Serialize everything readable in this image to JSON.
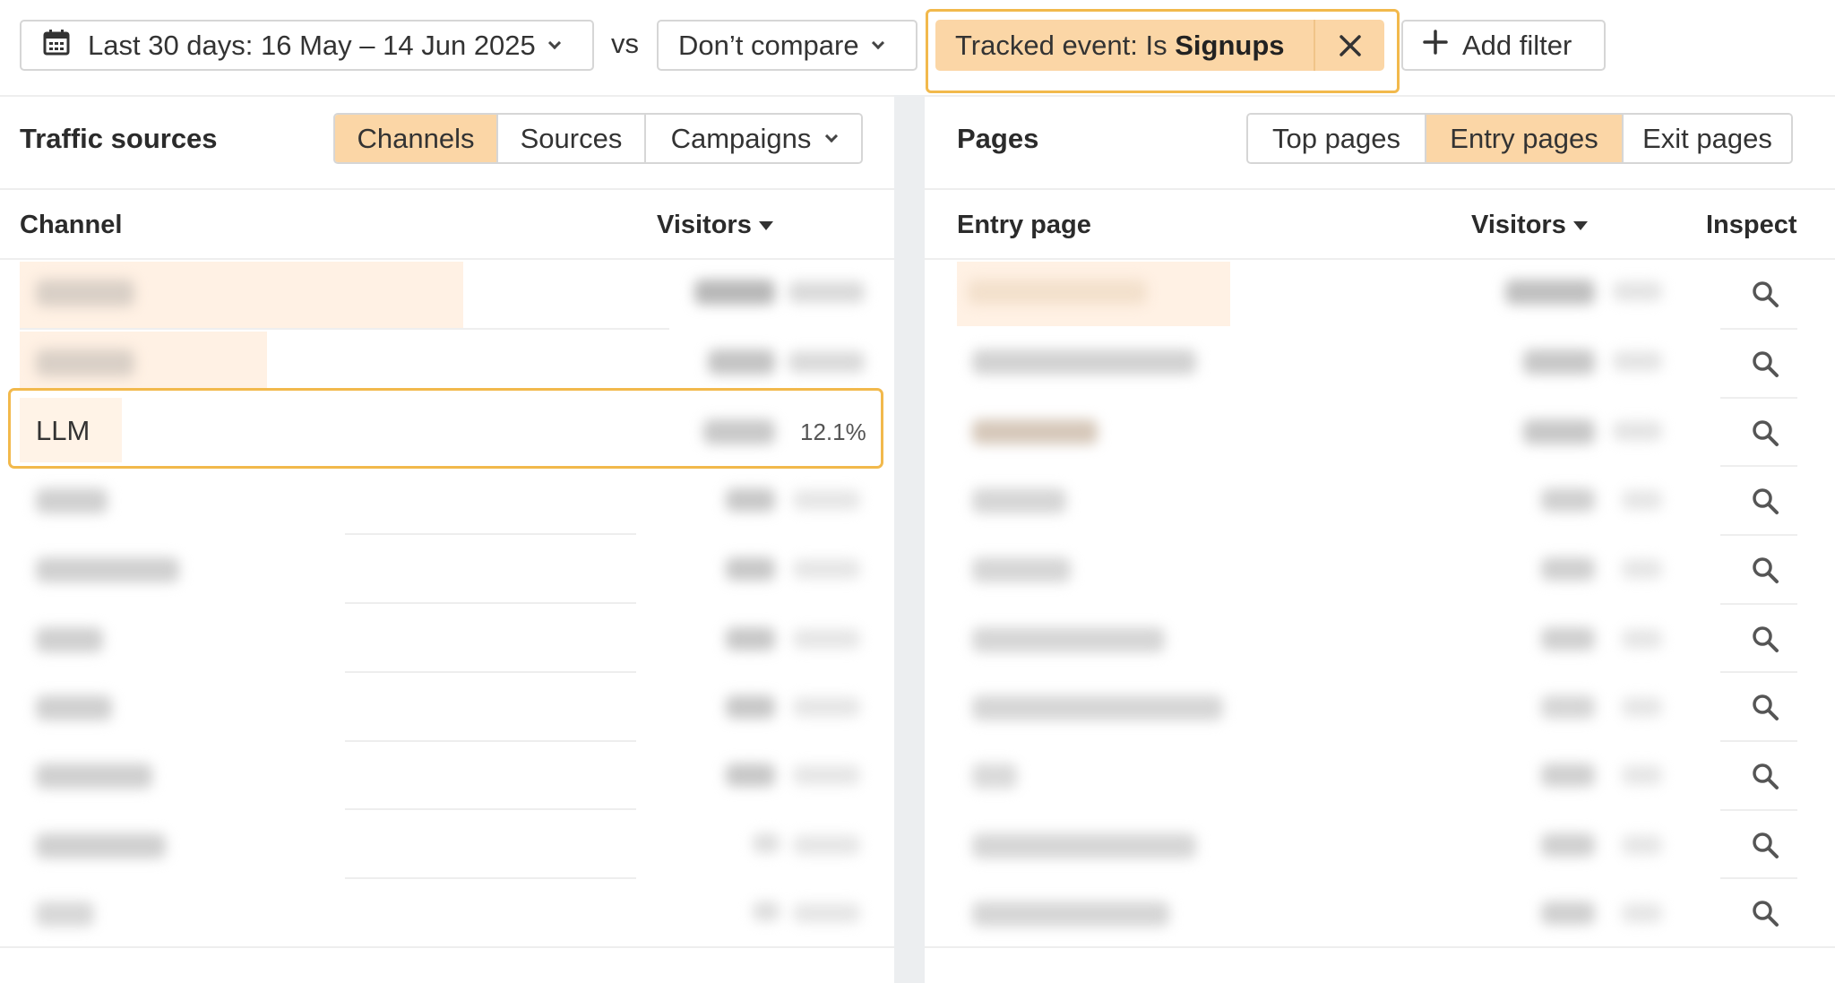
{
  "toolbar": {
    "date_range": "Last 30 days: 16 May – 14 Jun 2025",
    "vs": "vs",
    "compare": "Don’t compare",
    "filter_prefix": "Tracked event: Is",
    "filter_value": "Signups",
    "add_filter": "Add filter"
  },
  "traffic": {
    "title": "Traffic sources",
    "tabs": [
      {
        "label": "Channels",
        "active": true
      },
      {
        "label": "Sources",
        "active": false
      },
      {
        "label": "Campaigns",
        "active": false
      }
    ],
    "col_channel": "Channel",
    "col_visitors": "Visitors",
    "highlight_row": {
      "label": "LLM",
      "percent": "12.1%"
    }
  },
  "pages": {
    "title": "Pages",
    "tabs": [
      {
        "label": "Top pages",
        "active": false
      },
      {
        "label": "Entry pages",
        "active": true
      },
      {
        "label": "Exit pages",
        "active": false
      }
    ],
    "col_entry": "Entry page",
    "col_visitors": "Visitors",
    "col_inspect": "Inspect"
  },
  "colors": {
    "accent": "#fbd6a6",
    "highlight_border": "#f2b94c",
    "bar_fill": "#fff1e4"
  },
  "icons": [
    "calendar-icon",
    "chevron-down-icon",
    "close-icon",
    "plus-icon",
    "sort-desc-icon",
    "search-icon"
  ]
}
